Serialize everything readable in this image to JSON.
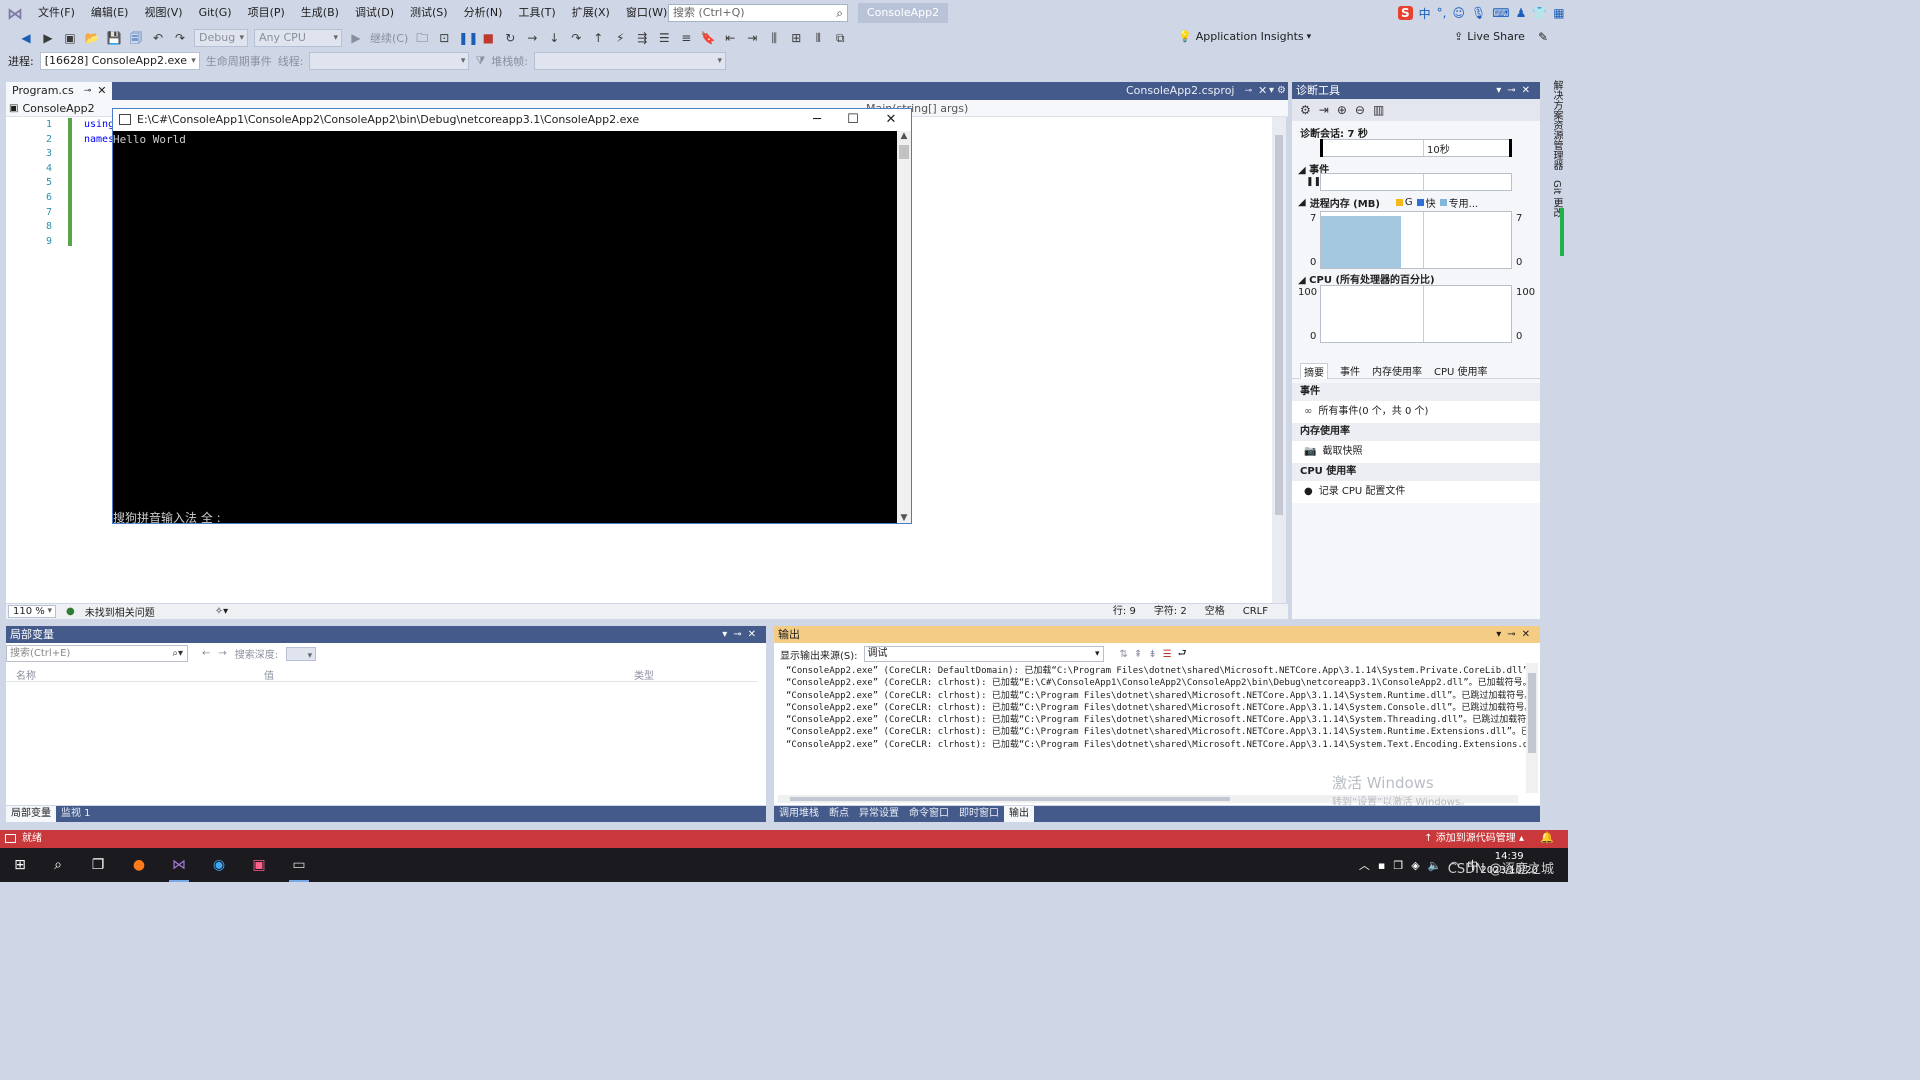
{
  "menubar": {
    "items": [
      "文件(F)",
      "编辑(E)",
      "视图(V)",
      "Git(G)",
      "项目(P)",
      "生成(B)",
      "调试(D)",
      "测试(S)",
      "分析(N)",
      "工具(T)",
      "扩展(X)",
      "窗口(W)",
      "帮助(H)"
    ],
    "search_placeholder": "搜索 (Ctrl+Q)",
    "app_title": "ConsoleApp2",
    "ime_brand": "S",
    "ime_mode": "中"
  },
  "toolbar": {
    "config": "Debug",
    "platform": "Any CPU",
    "continue_label": "继续(C)",
    "app_insights": "Application Insights",
    "live_share": "Live Share"
  },
  "toolbar2": {
    "process_label": "进程:",
    "process_value": "[16628] ConsoleApp2.exe",
    "lifecycle_label": "生命周期事件",
    "thread_label": "线程:",
    "stackframe_label": "堆栈帧:"
  },
  "editor": {
    "tabs": [
      {
        "label": "Program.cs",
        "active": true
      },
      {
        "label": "ConsoleApp2.csproj",
        "active": false
      }
    ],
    "nav_project": "ConsoleApp2",
    "nav_method": "Main(string[] args)",
    "line_numbers": [
      "1",
      "2",
      "3",
      "4",
      "5",
      "6",
      "7",
      "8",
      "9"
    ],
    "code": [
      "using",
      "names",
      "",
      "",
      "",
      "",
      "",
      "",
      ""
    ],
    "zoom": "110 %",
    "issues": "未找到相关问题",
    "line": "行: 9",
    "char": "字符: 2",
    "spaces": "空格",
    "eol": "CRLF"
  },
  "console": {
    "title": "E:\\C#\\ConsoleApp1\\ConsoleApp2\\ConsoleApp2\\bin\\Debug\\netcoreapp3.1\\ConsoleApp2.exe",
    "output": "Hello World",
    "ime_status": "搜狗拼音输入法 全 :"
  },
  "diagnostics": {
    "title": "诊断工具",
    "session": "诊断会话: 7 秒",
    "timeline_label": "10秒",
    "events_label": "事件",
    "memory_label": "进程内存 (MB)",
    "memory_legend": [
      {
        "label": "G",
        "color": "#f2b81c"
      },
      {
        "label": "快",
        "color": "#2f6fd6"
      },
      {
        "label": "专用...",
        "color": "#7fb6da"
      }
    ],
    "memory_max": "7",
    "memory_min": "0",
    "memory_fill_fraction": 0.42,
    "cpu_label": "CPU (所有处理器的百分比)",
    "cpu_max": "100",
    "cpu_min": "0",
    "tabs": [
      "摘要",
      "事件",
      "内存使用率",
      "CPU 使用率"
    ],
    "section_events": "事件",
    "all_events": "所有事件(0 个，共 0 个)",
    "section_memory": "内存使用率",
    "snapshot": "截取快照",
    "section_cpu": "CPU 使用率",
    "record_cpu": "记录 CPU 配置文件"
  },
  "right_strip": {
    "items": [
      "解决方案资源管理器",
      "Git 更改"
    ]
  },
  "locals": {
    "title": "局部变量",
    "search_placeholder": "搜索(Ctrl+E)",
    "depth_label": "搜索深度:",
    "columns": [
      "名称",
      "值",
      "类型"
    ],
    "tabs": [
      {
        "label": "局部变量",
        "active": true
      },
      {
        "label": "监视 1",
        "active": false
      }
    ]
  },
  "output": {
    "title": "输出",
    "source_label": "显示输出来源(S):",
    "source_value": "调试",
    "lines": [
      "“ConsoleApp2.exe” (CoreCLR: DefaultDomain): 已加载“C:\\Program Files\\dotnet\\shared\\Microsoft.NETCore.App\\3.1.14\\System.Private.CoreLib.dll”。已跳过加载",
      "“ConsoleApp2.exe” (CoreCLR: clrhost): 已加载“E:\\C#\\ConsoleApp1\\ConsoleApp2\\ConsoleApp2\\bin\\Debug\\netcoreapp3.1\\ConsoleApp2.dll”。已加载符号。",
      "“ConsoleApp2.exe” (CoreCLR: clrhost): 已加载“C:\\Program Files\\dotnet\\shared\\Microsoft.NETCore.App\\3.1.14\\System.Runtime.dll”。已跳过加载符号。模块进行",
      "“ConsoleApp2.exe” (CoreCLR: clrhost): 已加载“C:\\Program Files\\dotnet\\shared\\Microsoft.NETCore.App\\3.1.14\\System.Console.dll”。已跳过加载符号。模块进行",
      "“ConsoleApp2.exe” (CoreCLR: clrhost): 已加载“C:\\Program Files\\dotnet\\shared\\Microsoft.NETCore.App\\3.1.14\\System.Threading.dll”。已跳过加载符号。模块进",
      "“ConsoleApp2.exe” (CoreCLR: clrhost): 已加载“C:\\Program Files\\dotnet\\shared\\Microsoft.NETCore.App\\3.1.14\\System.Runtime.Extensions.dll”。已跳过加载符",
      "“ConsoleApp2.exe” (CoreCLR: clrhost): 已加载“C:\\Program Files\\dotnet\\shared\\Microsoft.NETCore.App\\3.1.14\\System.Text.Encoding.Extensions.dll”。已跳过"
    ],
    "tabs": [
      {
        "label": "调用堆栈",
        "active": false
      },
      {
        "label": "断点",
        "active": false
      },
      {
        "label": "异常设置",
        "active": false
      },
      {
        "label": "命令窗口",
        "active": false
      },
      {
        "label": "即时窗口",
        "active": false
      },
      {
        "label": "输出",
        "active": true
      }
    ],
    "activate_title": "激活 Windows",
    "activate_sub": "转到“设置”以激活 Windows。"
  },
  "statusbar": {
    "left": "就绪",
    "right": "↑ 添加到源代码管理 ▴"
  },
  "taskbar": {
    "ime": "中",
    "time": "14:39",
    "date": "2023/10/20",
    "watermark": "CSDN @逐鹿之城"
  }
}
